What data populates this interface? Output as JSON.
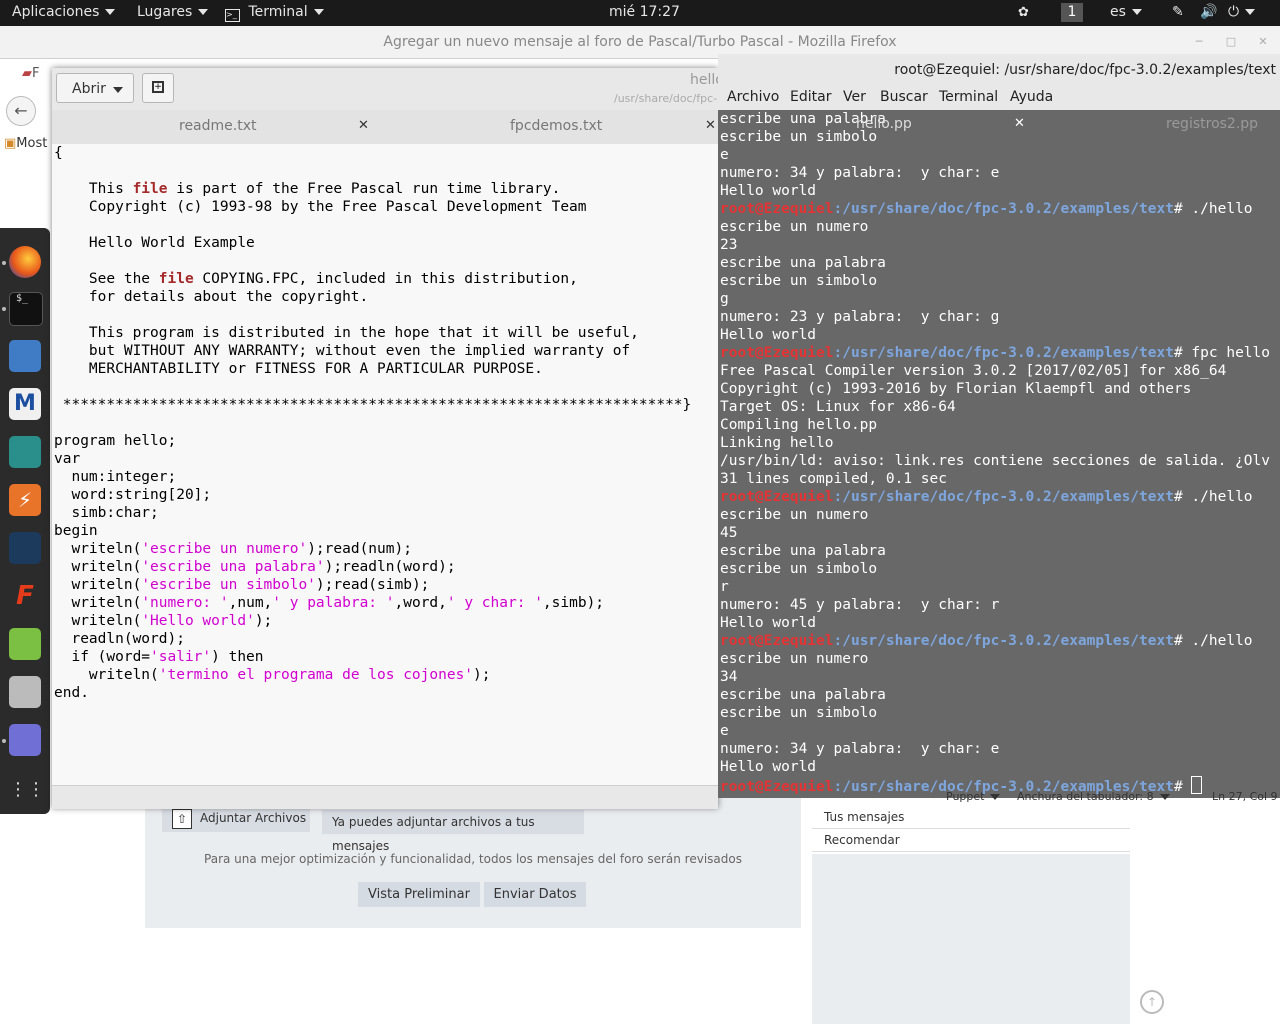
{
  "topbar": {
    "apps": "Aplicaciones",
    "places": "Lugares",
    "terminal": "Terminal",
    "clock": "mié 17:27",
    "workspace": "1",
    "lang": "es"
  },
  "firefox": {
    "title": "Agregar un nuevo mensaje al foro de Pascal/Turbo Pascal - Mozilla Firefox",
    "tab_partial": "F",
    "bookmark_partial": "Most",
    "attach_label": "Adjuntar Archivos",
    "attach_note": "Ya puedes adjuntar archivos a tus mensajes",
    "optimization_note": "Para una mejor optimización y funcionalidad, todos los mensajes del foro serán revisados",
    "preview_button": "Vista Preliminar",
    "send_button": "Enviar Datos",
    "side_links": [
      "Tus mensajes",
      "Recomendar"
    ]
  },
  "gedit": {
    "open_label": "Abrir",
    "title": "hello",
    "subtitle": "/usr/share/doc/fpc-",
    "tabs": [
      {
        "label": "readme.txt"
      },
      {
        "label": "fpcdemos.txt"
      }
    ],
    "status": {
      "language": "Puppet",
      "tab_width": "Anchura del tabulador: 8",
      "position": "Ln 27, Col 9"
    }
  },
  "terminal": {
    "title": "root@Ezequiel: /usr/share/doc/fpc-3.0.2/examples/text",
    "menu": [
      "Archivo",
      "Editar",
      "Ver",
      "Buscar",
      "Terminal",
      "Ayuda"
    ],
    "tab_active": "hello.pp",
    "tab_other": "registros2.pp",
    "prompt_user": "root@Ezequiel",
    "prompt_path": ":/usr/share/doc/fpc-3.0.2/examples/text",
    "lines": [
      "escribe una palabra",
      "escribe un simbolo",
      "e",
      "numero: 34 y palabra:  y char: e",
      "Hello world",
      "# ./hello",
      "escribe un numero",
      "23",
      "escribe una palabra",
      "escribe un simbolo",
      "g",
      "numero: 23 y palabra:  y char: g",
      "Hello world",
      "# fpc hello",
      "Free Pascal Compiler version 3.0.2 [2017/02/05] for x86_64",
      "Copyright (c) 1993-2016 by Florian Klaempfl and others",
      "Target OS: Linux for x86-64",
      "Compiling hello.pp",
      "Linking hello",
      "/usr/bin/ld: aviso: link.res contiene secciones de salida. ¿Olv",
      "31 lines compiled, 0.1 sec",
      "# ./hello",
      "escribe un numero",
      "45",
      "escribe una palabra",
      "escribe un simbolo",
      "r",
      "numero: 45 y palabra:  y char: r",
      "Hello world",
      "# ./hello",
      "escribe un numero",
      "34",
      "escribe una palabra",
      "escribe un simbolo",
      "e",
      "numero: 34 y palabra:  y char: e",
      "Hello world",
      "# "
    ]
  },
  "code": {
    "segments": [
      [
        "{\n\n    This ",
        ""
      ],
      [
        "file",
        "kw"
      ],
      [
        " is part of the Free Pascal run time library.\n    Copyright (c) 1993-98 by the Free Pascal Development Team\n\n    Hello World Example\n\n    See the ",
        ""
      ],
      [
        "file",
        "kw"
      ],
      [
        " COPYING.FPC, included in this distribution,\n    for details about the copyright.\n\n    This program is distributed in the hope that it will be useful,\n    but WITHOUT ANY WARRANTY; without even the implied warranty of\n    MERCHANTABILITY or FITNESS FOR A PARTICULAR PURPOSE.\n\n ***********************************************************************}\n\nprogram hello;\nvar\n  num:integer;\n  word:string[20];\n  simb:char;\nbegin\n  writeln(",
        ""
      ],
      [
        "'escribe un numero'",
        "str"
      ],
      [
        ");read(num);\n  writeln(",
        ""
      ],
      [
        "'escribe una palabra'",
        "str"
      ],
      [
        ");readln(word);\n  writeln(",
        ""
      ],
      [
        "'escribe un simbolo'",
        "str"
      ],
      [
        ");read(simb);\n  writeln(",
        ""
      ],
      [
        "'numero: '",
        "str"
      ],
      [
        ",num,",
        ""
      ],
      [
        "' y palabra: '",
        "str"
      ],
      [
        ",word,",
        ""
      ],
      [
        "' y char: '",
        "str"
      ],
      [
        ",simb);\n  writeln(",
        ""
      ],
      [
        "'Hello world'",
        "str"
      ],
      [
        ");\n  readln(word);\n  if (word=",
        ""
      ],
      [
        "'salir'",
        "str"
      ],
      [
        ") then\n    writeln(",
        ""
      ],
      [
        "'termino el programa de los cojones'",
        "str"
      ],
      [
        ");\nend.",
        ""
      ]
    ]
  },
  "colors": {
    "topbar": "#1a1a1a",
    "terminal_bg": "#686868",
    "prompt_user": "#e53333",
    "prompt_path": "#7ea6de",
    "keyword": "#a52a2a",
    "string": "#d100d1"
  }
}
